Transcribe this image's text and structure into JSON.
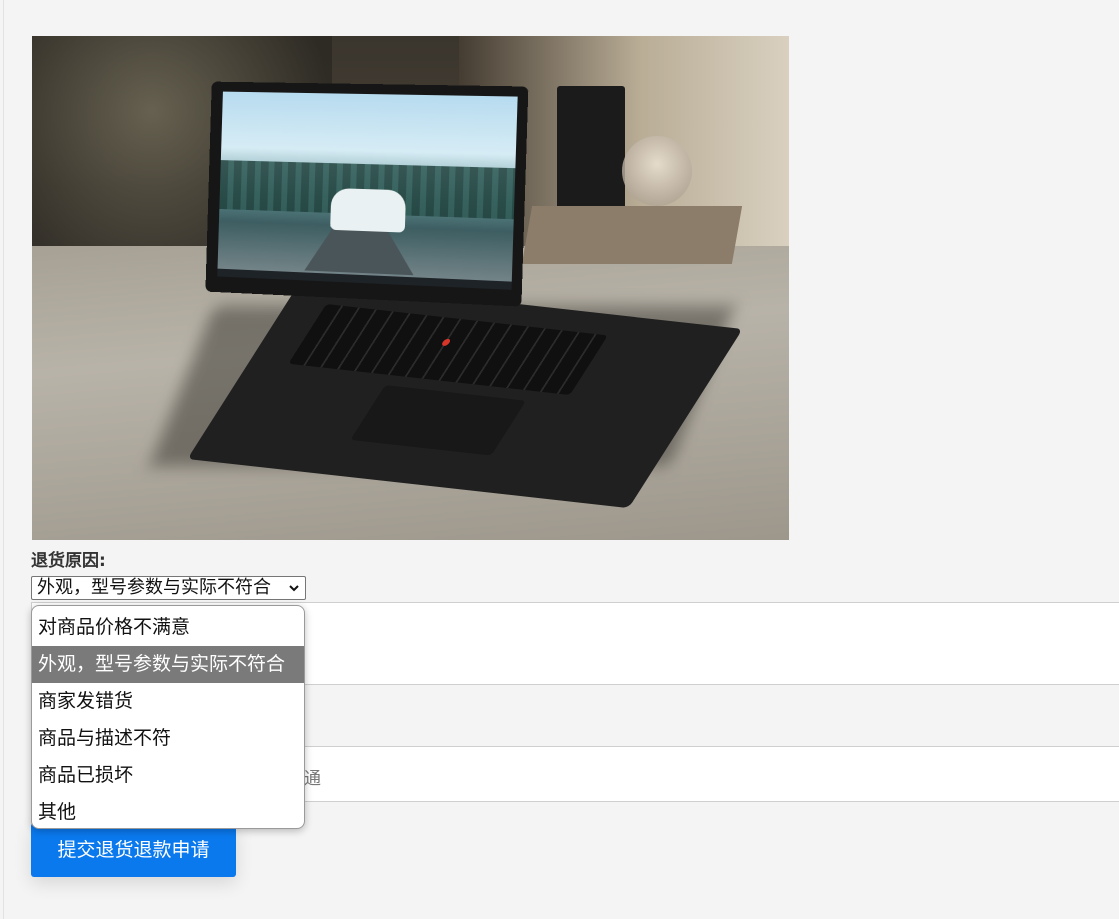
{
  "form": {
    "reason_label": "退货原因:",
    "select": {
      "selected_value": "外观，型号参数与实际不符合",
      "options": [
        "对商品价格不满意",
        "外观，型号参数与实际不符合",
        "商家发错货",
        "商品与描述不符",
        "商品已损坏",
        "其他"
      ],
      "selected_index": 1,
      "is_open": true
    },
    "partial_placeholder": "通",
    "submit_label": "提交退货退款申请"
  },
  "colors": {
    "submit_button": "#0a79ee",
    "selected_option_bg": "#7a7a7a",
    "page_bg": "#f4f4f4"
  },
  "icons": {
    "select_arrow": "chevron-down-icon"
  }
}
